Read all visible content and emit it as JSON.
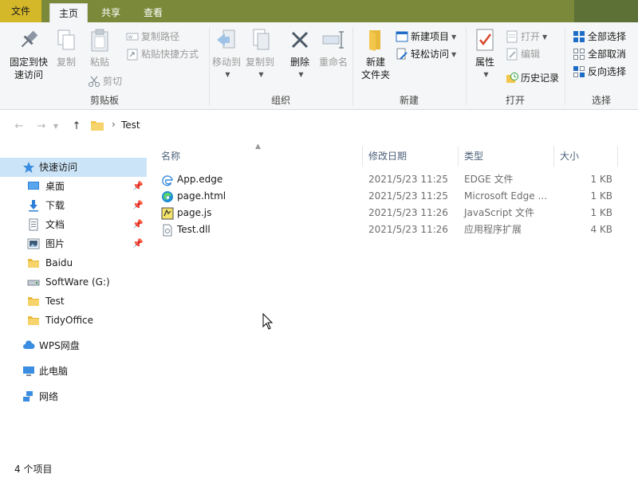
{
  "tabs": {
    "file": "文件",
    "home": "主页",
    "share": "共享",
    "view": "查看"
  },
  "ribbon": {
    "clipboard": {
      "label": "剪贴板",
      "pin": "固定到快\n速访问",
      "pin_line1": "固定到快",
      "pin_line2": "速访问",
      "copy": "复制",
      "paste": "粘贴",
      "copy_path": "复制路径",
      "paste_shortcut": "粘贴快捷方式",
      "cut": "剪切"
    },
    "organize": {
      "label": "组织",
      "move_to": "移动到",
      "copy_to": "复制到",
      "delete": "删除",
      "rename": "重命名"
    },
    "new": {
      "label": "新建",
      "new_folder_line1": "新建",
      "new_folder_line2": "文件夹",
      "new_item": "新建项目",
      "easy_access": "轻松访问"
    },
    "open": {
      "label": "打开",
      "properties": "属性",
      "open": "打开",
      "edit": "编辑",
      "history": "历史记录"
    },
    "select": {
      "label": "选择",
      "select_all": "全部选择",
      "select_none": "全部取消",
      "invert": "反向选择"
    }
  },
  "address": {
    "crumb": "Test"
  },
  "nav": {
    "quick_access": "快速访问",
    "items": [
      {
        "label": "桌面",
        "icon": "desktop-icon",
        "pinned": true
      },
      {
        "label": "下载",
        "icon": "download-icon",
        "pinned": true
      },
      {
        "label": "文档",
        "icon": "document-icon",
        "pinned": true
      },
      {
        "label": "图片",
        "icon": "picture-icon",
        "pinned": true
      },
      {
        "label": "Baidu",
        "icon": "folder-icon",
        "pinned": false
      },
      {
        "label": "SoftWare (G:)",
        "icon": "drive-icon",
        "pinned": false
      },
      {
        "label": "Test",
        "icon": "folder-icon",
        "pinned": false
      },
      {
        "label": "TidyOffice",
        "icon": "folder-icon",
        "pinned": false
      }
    ],
    "wps": "WPS网盘",
    "this_pc": "此电脑",
    "network": "网络"
  },
  "columns": {
    "name": "名称",
    "modified": "修改日期",
    "type": "类型",
    "size": "大小"
  },
  "files": [
    {
      "name": "App.edge",
      "modified": "2021/5/23 11:25",
      "type": "EDGE 文件",
      "size": "1 KB",
      "icon": "edge-file-icon"
    },
    {
      "name": "page.html",
      "modified": "2021/5/23 11:25",
      "type": "Microsoft Edge ...",
      "size": "1 KB",
      "icon": "edge-browser-icon"
    },
    {
      "name": "page.js",
      "modified": "2021/5/23 11:26",
      "type": "JavaScript 文件",
      "size": "1 KB",
      "icon": "js-file-icon"
    },
    {
      "name": "Test.dll",
      "modified": "2021/5/23 11:26",
      "type": "应用程序扩展",
      "size": "4 KB",
      "icon": "dll-file-icon"
    }
  ],
  "status": {
    "count": "4 个项目"
  },
  "colors": {
    "title_bar": "#7a8a3a",
    "file_tab": "#d4b82a",
    "selected_nav": "#cce4f7",
    "folder": "#f3c74d",
    "accent": "#1e6ec8"
  }
}
